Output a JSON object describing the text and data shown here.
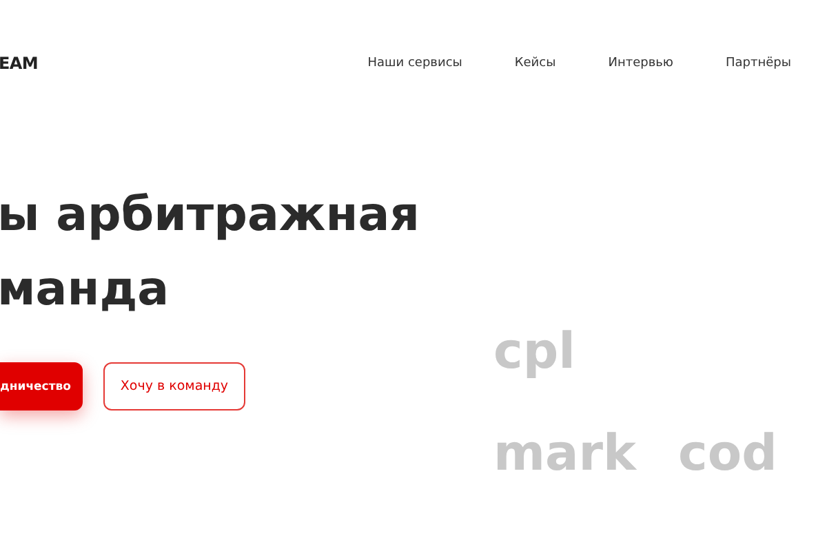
{
  "header": {
    "logo": "EAM",
    "nav": [
      {
        "label": "Наши сервисы"
      },
      {
        "label": "Кейсы"
      },
      {
        "label": "Интервью"
      },
      {
        "label": "Партнёры"
      }
    ]
  },
  "hero": {
    "title_lines": [
      "ы арбитражная",
      "манда"
    ],
    "buttons": [
      {
        "label": "дничество",
        "kind": "primary"
      },
      {
        "label": "Хочу в команду",
        "kind": "outline"
      }
    ],
    "background_words": [
      {
        "text": "cpl"
      },
      {
        "text": "mark"
      },
      {
        "text": "cod"
      }
    ]
  }
}
